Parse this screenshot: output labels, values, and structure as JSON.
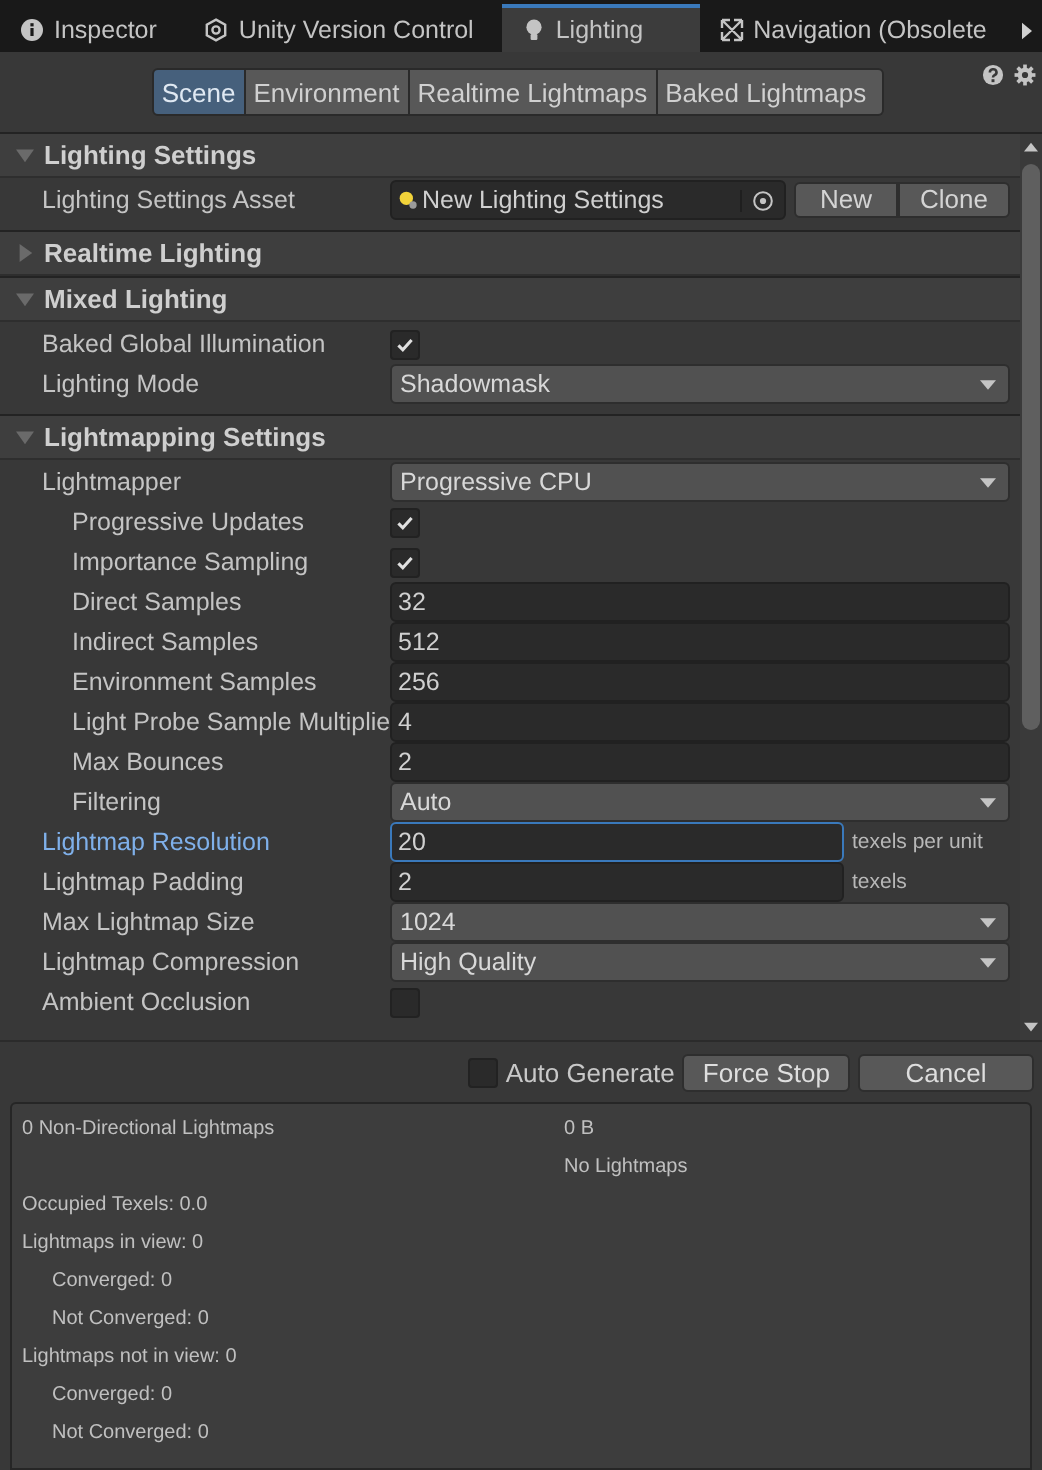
{
  "window_tabs": [
    {
      "label": "Inspector",
      "selected": false
    },
    {
      "label": "Unity Version Control",
      "selected": false
    },
    {
      "label": "Lighting",
      "selected": true
    },
    {
      "label": "Navigation (Obsolete",
      "selected": false
    }
  ],
  "sub_tabs": [
    {
      "label": "Scene",
      "selected": true
    },
    {
      "label": "Environment",
      "selected": false
    },
    {
      "label": "Realtime Lightmaps",
      "selected": false
    },
    {
      "label": "Baked Lightmaps",
      "selected": false
    }
  ],
  "sections": [
    {
      "title": "Lighting Settings",
      "expanded": true,
      "rows": [
        {
          "kind": "object",
          "label": "Lighting Settings Asset",
          "value": "New Lighting Settings",
          "buttons": [
            "New",
            "Clone"
          ]
        }
      ]
    },
    {
      "title": "Realtime Lighting",
      "expanded": false
    },
    {
      "title": "Mixed Lighting",
      "expanded": true,
      "rows": [
        {
          "kind": "checkbox",
          "label": "Baked Global Illumination",
          "checked": true
        },
        {
          "kind": "dropdown",
          "label": "Lighting Mode",
          "value": "Shadowmask"
        }
      ]
    },
    {
      "title": "Lightmapping Settings",
      "expanded": true,
      "rows": [
        {
          "kind": "dropdown",
          "label": "Lightmapper",
          "value": "Progressive CPU",
          "children": [
            {
              "kind": "checkbox",
              "label": "Progressive Updates",
              "checked": true
            },
            {
              "kind": "checkbox",
              "label": "Importance Sampling",
              "checked": true
            },
            {
              "kind": "number",
              "label": "Direct Samples",
              "value": "32"
            },
            {
              "kind": "number",
              "label": "Indirect Samples",
              "value": "512"
            },
            {
              "kind": "number",
              "label": "Environment Samples",
              "value": "256"
            },
            {
              "kind": "number",
              "label": "Light Probe Sample Multiplie",
              "value": "4"
            },
            {
              "kind": "number",
              "label": "Max Bounces",
              "value": "2"
            },
            {
              "kind": "dropdown",
              "label": "Filtering",
              "value": "Auto"
            }
          ]
        },
        {
          "kind": "number",
          "label": "Lightmap Resolution",
          "value": "20",
          "unit": "texels per unit",
          "focused": true
        },
        {
          "kind": "number",
          "label": "Lightmap Padding",
          "value": "2",
          "unit": "texels",
          "focused": false
        },
        {
          "kind": "dropdown",
          "label": "Max Lightmap Size",
          "value": "1024"
        },
        {
          "kind": "dropdown",
          "label": "Lightmap Compression",
          "value": "High Quality"
        },
        {
          "kind": "checkbox",
          "label": "Ambient Occlusion",
          "checked": false
        }
      ]
    }
  ],
  "auto_generate": {
    "label": "Auto Generate",
    "checked": false
  },
  "bake_buttons": [
    "Force Stop",
    "Cancel"
  ],
  "stats": {
    "summary": {
      "label": "0 Non-Directional Lightmaps",
      "size": "0 B",
      "note": "No Lightmaps"
    },
    "lines": [
      {
        "text": "Occupied Texels: 0.0"
      },
      {
        "text": "Lightmaps in view: 0",
        "children": [
          {
            "text": "Converged: 0"
          },
          {
            "text": "Not Converged: 0"
          }
        ]
      },
      {
        "text": "Lightmaps not in view: 0",
        "children": [
          {
            "text": "Converged: 0"
          },
          {
            "text": "Not Converged: 0"
          }
        ]
      }
    ]
  }
}
